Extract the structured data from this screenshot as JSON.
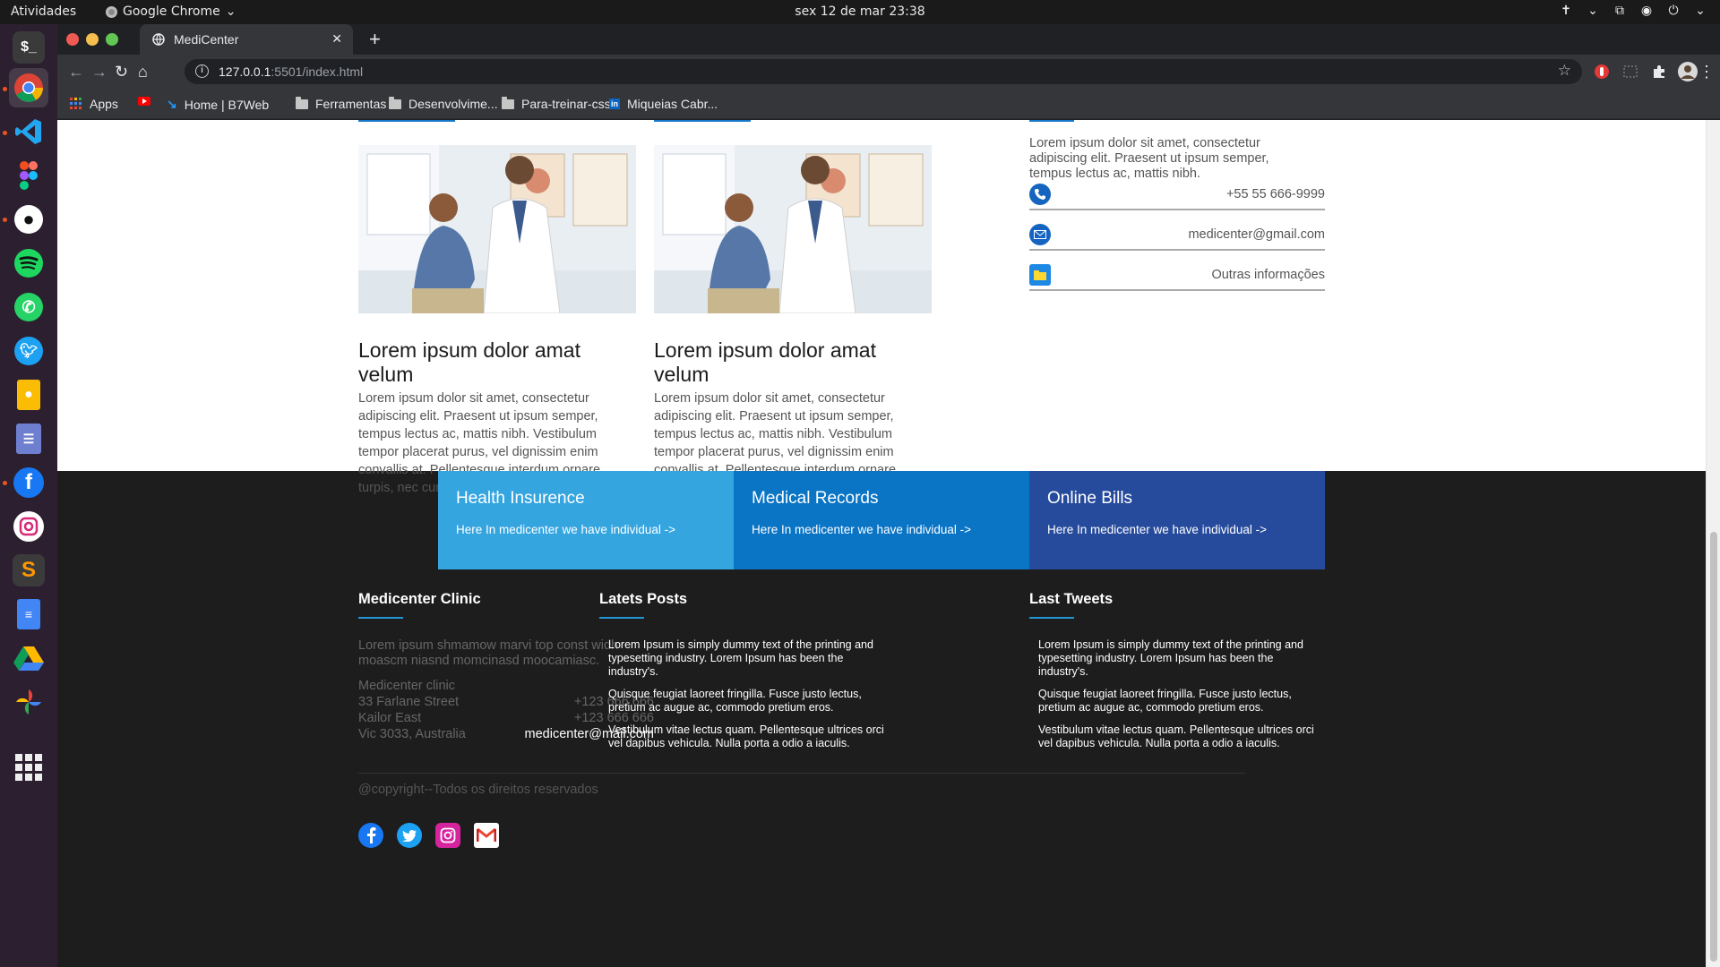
{
  "os": {
    "activities": "Atividades",
    "app_name": "Google Chrome",
    "clock": "sex 12 de mar  23:38"
  },
  "browser": {
    "tab_title": "MediCenter",
    "url_host": "127.0.0.1",
    "url_rest": ":5501/index.html",
    "bookmarks": [
      "Apps",
      "Home | B7Web",
      "Ferramentas",
      "Desenvolvime...",
      "Para-treinar-css",
      "Miqueias Cabr..."
    ]
  },
  "cards": [
    {
      "title": "Lorem ipsum dolor amat velum",
      "text": "Lorem ipsum dolor sit amet, consectetur adipiscing elit. Praesent ut ipsum semper, tempus lectus ac, mattis nibh. Vestibulum tempor placerat purus, vel dignissim enim convallis at. Pellentesque interdum ornare turpis, nec cursus eros posuere vitae."
    },
    {
      "title": "Lorem ipsum dolor amat velum",
      "text": "Lorem ipsum dolor sit amet, consectetur adipiscing elit. Praesent ut ipsum semper, tempus lectus ac, mattis nibh. Vestibulum tempor placerat purus, vel dignissim enim convallis at. Pellentesque interdum ornare turpis, nec cursus eros posuere vitae."
    }
  ],
  "contact": {
    "intro": "Lorem ipsum dolor sit amet, consectetur adipiscing elit. Praesent ut ipsum semper, tempus lectus ac, mattis nibh.",
    "phone": "+55 55 666-9999",
    "email": "medicenter@gmail.com",
    "more": "Outras informações"
  },
  "services": [
    {
      "title": "Health Insurence",
      "text": "Here In medicenter we have individual ->",
      "color": "#35a5e0"
    },
    {
      "title": "Medical Records",
      "text": "Here In medicenter we have individual ->",
      "color": "#0a74c5"
    },
    {
      "title": "Online Bills",
      "text": "Here In medicenter we have individual ->",
      "color": "#274b9c"
    }
  ],
  "footer": {
    "clinic": {
      "heading": "Medicenter Clinic",
      "text": "Lorem ipsum shmamow marvi top const widh moascm niasnd momcinasd moocamiasc.",
      "name": "Medicenter clinic",
      "street": "33 Farlane Street",
      "phone1": "+123 666 666",
      "district": "Kailor East",
      "phone2": "+123 666 666",
      "region": "Vic 3033, Australia",
      "email": "medicenter@mail.com"
    },
    "posts": {
      "heading": "Latets Posts",
      "items": [
        "Lorem Ipsum is simply dummy text of the printing and typesetting industry. Lorem Ipsum has been the industry's.",
        "Quisque feugiat laoreet fringilla. Fusce justo lectus, pretium ac augue ac, commodo pretium eros.",
        "Vestibulum vitae lectus quam. Pellentesque ultrices orci vel dapibus vehicula. Nulla porta a odio a iaculis."
      ]
    },
    "tweets": {
      "heading": "Last Tweets",
      "items": [
        "Lorem Ipsum is simply dummy text of the printing and typesetting industry. Lorem Ipsum has been the industry's.",
        "Quisque feugiat laoreet fringilla. Fusce justo lectus, pretium ac augue ac, commodo pretium eros.",
        "Vestibulum vitae lectus quam. Pellentesque ultrices orci vel dapibus vehicula. Nulla porta a odio a iaculis."
      ]
    },
    "social": [
      "facebook-icon",
      "twitter-icon",
      "instagram-icon",
      "gmail-icon"
    ],
    "copyright": "@copyright--Todos os direitos reservados"
  }
}
